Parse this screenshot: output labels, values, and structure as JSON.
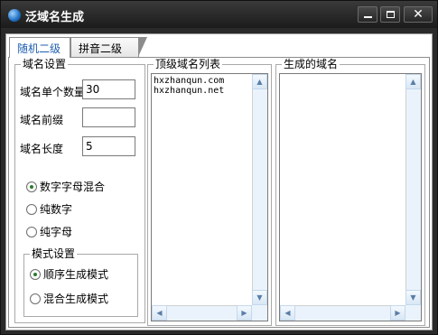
{
  "window": {
    "title": "泛域名生成"
  },
  "controls": {
    "minimize": "minimize",
    "maximize": "maximize",
    "close": "✕"
  },
  "tabs": [
    {
      "label": "随机二级",
      "active": true
    },
    {
      "label": "拼音二级",
      "active": false
    }
  ],
  "domain_settings": {
    "group_label": "域名设置",
    "count_label": "域名单个数量",
    "count_value": "30",
    "prefix_label": "域名前缀",
    "prefix_value": "",
    "length_label": "域名长度",
    "length_value": "5",
    "char_options": [
      {
        "label": "数字字母混合",
        "checked": true
      },
      {
        "label": "纯数字",
        "checked": false
      },
      {
        "label": "纯字母",
        "checked": false
      }
    ]
  },
  "mode_settings": {
    "group_label": "模式设置",
    "options": [
      {
        "label": "顺序生成模式",
        "checked": true
      },
      {
        "label": "混合生成模式",
        "checked": false
      }
    ]
  },
  "top_domains": {
    "group_label": "顶级域名列表",
    "items": [
      "hxzhanqun.com",
      "hxzhanqun.net"
    ]
  },
  "generated": {
    "group_label": "生成的域名",
    "items": []
  },
  "scroll_glyphs": {
    "up": "▲",
    "down": "▼",
    "left": "◀",
    "right": "▶"
  }
}
